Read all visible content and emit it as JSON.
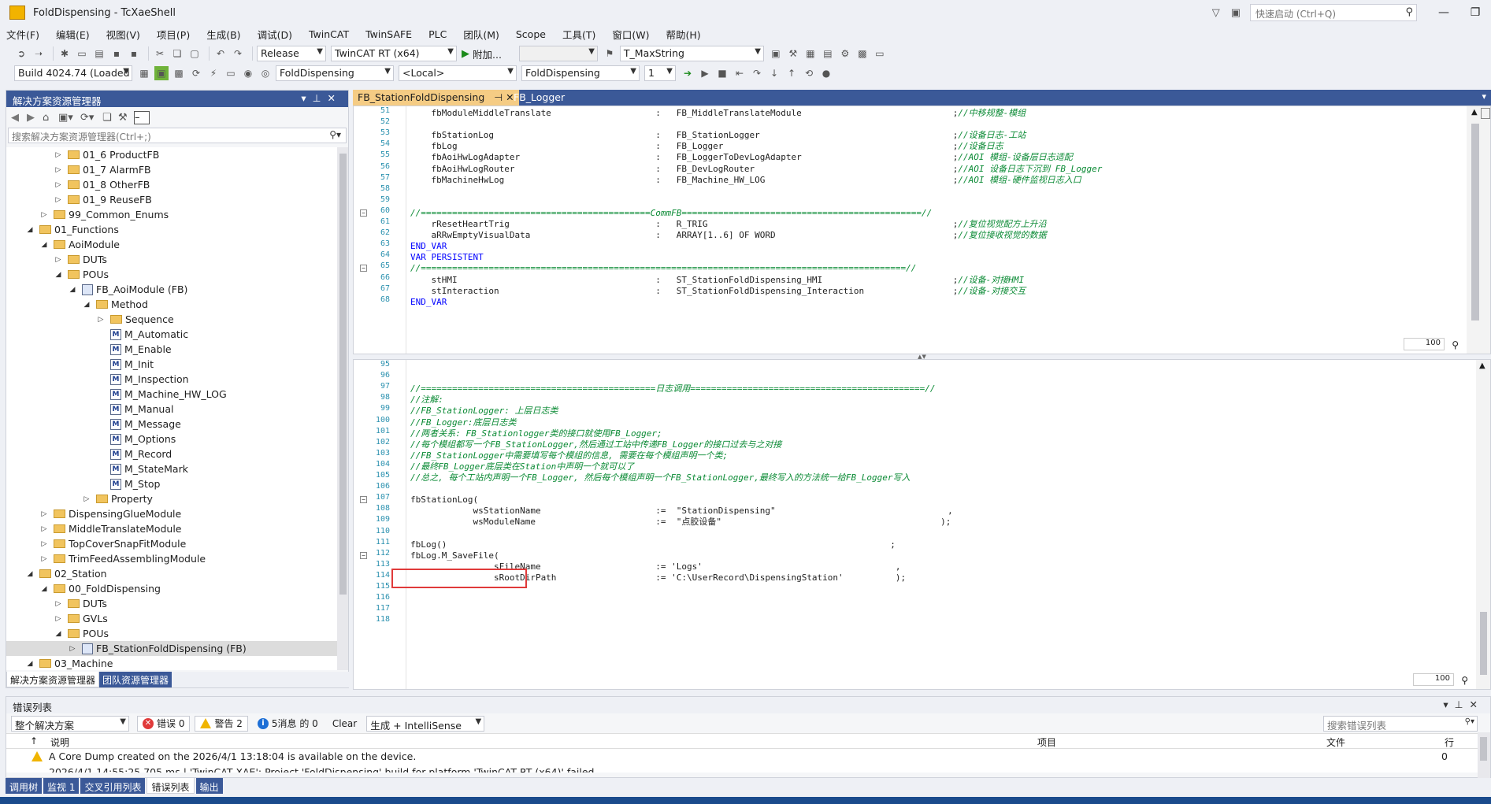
{
  "window": {
    "title": "FoldDispensing - TcXaeShell",
    "quick_launch_placeholder": "快速启动 (Ctrl+Q)"
  },
  "menu": [
    "文件(F)",
    "编辑(E)",
    "视图(V)",
    "项目(P)",
    "生成(B)",
    "调试(D)",
    "TwinCAT",
    "TwinSAFE",
    "PLC",
    "团队(M)",
    "Scope",
    "工具(T)",
    "窗口(W)",
    "帮助(H)"
  ],
  "toolbar1": {
    "config": "Release",
    "platform": "TwinCAT RT (x64)",
    "attach": "附加...",
    "find_combo": "T_MaxString"
  },
  "toolbar2": {
    "build": "Build 4024.74 (Loaded",
    "project": "FoldDispensing",
    "target": "<Local>",
    "plc_project": "FoldDispensing",
    "task": "1"
  },
  "solution_explorer": {
    "title": "解决方案资源管理器",
    "search_placeholder": "搜索解决方案资源管理器(Ctrl+;)",
    "nodes": [
      {
        "label": "01_6 ProductFB"
      },
      {
        "label": "01_7 AlarmFB"
      },
      {
        "label": "01_8 OtherFB"
      },
      {
        "label": "01_9 ReuseFB"
      },
      {
        "label": "99_Common_Enums"
      },
      {
        "label": "01_Functions"
      },
      {
        "label": "AoiModule"
      },
      {
        "label": "DUTs"
      },
      {
        "label": "POUs"
      },
      {
        "label": "FB_AoiModule (FB)"
      },
      {
        "label": "Method"
      },
      {
        "label": "Sequence"
      },
      {
        "label": "M_Automatic"
      },
      {
        "label": "M_Enable"
      },
      {
        "label": "M_Init"
      },
      {
        "label": "M_Inspection"
      },
      {
        "label": "M_Machine_HW_LOG"
      },
      {
        "label": "M_Manual"
      },
      {
        "label": "M_Message"
      },
      {
        "label": "M_Options"
      },
      {
        "label": "M_Record"
      },
      {
        "label": "M_StateMark"
      },
      {
        "label": "M_Stop"
      },
      {
        "label": "Property"
      },
      {
        "label": "DispensingGlueModule"
      },
      {
        "label": "MiddleTranslateModule"
      },
      {
        "label": "TopCoverSnapFitModule"
      },
      {
        "label": "TrimFeedAssemblingModule"
      },
      {
        "label": "02_Station"
      },
      {
        "label": "00_FoldDispensing"
      },
      {
        "label": "DUTs"
      },
      {
        "label": "GVLs"
      },
      {
        "label": "POUs"
      },
      {
        "label": "FB_StationFoldDispensing (FB)"
      },
      {
        "label": "03_Machine"
      }
    ],
    "bottom_tabs": [
      "解决方案资源管理器",
      "团队资源管理器"
    ]
  },
  "doc_tabs": [
    "FB_StationFoldDispensing",
    "FB_Logger"
  ],
  "decl_editor": {
    "zoom": "100",
    "lines": [
      {
        "n": "51",
        "t": "    fbModuleMiddleTranslate                    :   FB_MiddleTranslateModule                             ;",
        "c": "//中移规整-模组"
      },
      {
        "n": "52",
        "t": "",
        "c": ""
      },
      {
        "n": "53",
        "t": "    fbStationLog                               :   FB_StationLogger                                     ;",
        "c": "//设备日志-工站"
      },
      {
        "n": "54",
        "t": "    fbLog                                      :   FB_Logger                                            ;",
        "c": "//设备日志"
      },
      {
        "n": "55",
        "t": "    fbAoiHwLogAdapter                          :   FB_LoggerToDevLogAdapter                             ;",
        "c": "//AOI 模组-设备层日志适配"
      },
      {
        "n": "56",
        "t": "    fbAoiHwLogRouter                           :   FB_DevLogRouter                                      ;",
        "c": "//AOI 设备日志下沉到 FB_Logger"
      },
      {
        "n": "57",
        "t": "    fbMachineHwLog                             :   FB_Machine_HW_LOG                                    ;",
        "c": "//AOI 模组-硬件监视日志入口"
      },
      {
        "n": "58",
        "t": "",
        "c": ""
      },
      {
        "n": "59",
        "t": "",
        "c": ""
      },
      {
        "n": "60",
        "t": "",
        "c": "//============================================CommFB==============================================//"
      },
      {
        "n": "61",
        "t": "    rResetHeartTrig                            :   R_TRIG                                               ;",
        "c": "//复位视觉配方上升沿"
      },
      {
        "n": "62",
        "t": "    aRRwEmptyVisualData                        :   ARRAY[1..6] OF WORD                                  ;",
        "c": "//复位接收视觉的数据"
      },
      {
        "n": "63",
        "t": "END_VAR",
        "c": ""
      },
      {
        "n": "64",
        "t": "VAR PERSISTENT",
        "c": ""
      },
      {
        "n": "65",
        "t": "",
        "c": "//=============================================================================================//"
      },
      {
        "n": "66",
        "t": "    stHMI                                      :   ST_StationFoldDispensing_HMI                         ;",
        "c": "//设备-对接HMI"
      },
      {
        "n": "67",
        "t": "    stInteraction                              :   ST_StationFoldDispensing_Interaction                 ;",
        "c": "//设备-对接交互"
      },
      {
        "n": "68",
        "t": "END_VAR",
        "c": ""
      }
    ]
  },
  "impl_editor": {
    "zoom": "100",
    "lines": [
      {
        "n": "95",
        "t": "",
        "c": ""
      },
      {
        "n": "96",
        "t": "",
        "c": ""
      },
      {
        "n": "97",
        "t": "",
        "c": "//=============================================日志调用=============================================//"
      },
      {
        "n": "98",
        "t": "",
        "c": "//注解:"
      },
      {
        "n": "99",
        "t": "",
        "c": "//FB_StationLogger: 上层日志类"
      },
      {
        "n": "100",
        "t": "",
        "c": "//FB_Logger:底层日志类"
      },
      {
        "n": "101",
        "t": "",
        "c": "//两者关系: FB_Stationlogger类的接口就使用FB_Logger;"
      },
      {
        "n": "102",
        "t": "",
        "c": "//每个模组都写一个FB_StationLogger,然后通过工站中传递FB_Logger的接口过去与之对接"
      },
      {
        "n": "103",
        "t": "",
        "c": "//FB_StationLogger中需要填写每个模组的信息, 需要在每个模组声明一个类;"
      },
      {
        "n": "104",
        "t": "",
        "c": "//最终FB_Logger底层类在Station中声明一个就可以了"
      },
      {
        "n": "105",
        "t": "",
        "c": "//总之, 每个工站内声明一个FB_Logger, 然后每个模组声明一个FB_StationLogger,最终写入的方法统一给FB_Logger写入"
      },
      {
        "n": "106",
        "t": "",
        "c": ""
      },
      {
        "n": "107",
        "t": "fbStationLog(",
        "c": ""
      },
      {
        "n": "108",
        "t": "            wsStationName                      :=  \"StationDispensing\"                                 ,",
        "c": ""
      },
      {
        "n": "109",
        "t": "            wsModuleName                       :=  \"点胶设备\"                                          );",
        "c": ""
      },
      {
        "n": "110",
        "t": "",
        "c": ""
      },
      {
        "n": "111",
        "t": "fbLog()                                                                                     ;",
        "c": ""
      },
      {
        "n": "112",
        "t": "fbLog.M_SaveFile(",
        "c": ""
      },
      {
        "n": "113",
        "t": "                sFileName                      := 'Logs'                                     ,",
        "c": ""
      },
      {
        "n": "114",
        "t": "                sRootDirPath                   := 'C:\\UserRecord\\DispensingStation'          );",
        "c": ""
      },
      {
        "n": "115",
        "t": "",
        "c": ""
      },
      {
        "n": "116",
        "t": "",
        "c": ""
      },
      {
        "n": "117",
        "t": "",
        "c": ""
      },
      {
        "n": "118",
        "t": "",
        "c": ""
      }
    ]
  },
  "error_list": {
    "title": "错误列表",
    "scope": "整个解决方案",
    "errors": "错误 0",
    "warnings": "警告 2",
    "messages": "5消息 的 0",
    "clear": "Clear",
    "source": "生成 + IntelliSense",
    "search_placeholder": "搜索错误列表",
    "columns": [
      "说明",
      "项目",
      "文件",
      "行"
    ],
    "rows": [
      {
        "desc": "A Core Dump created on the 2026/4/1 13:18:04 is available on the device.",
        "line": "0"
      },
      {
        "desc": "2026/4/1 14:55:25 705 ms | 'TwinCAT XAE': Project 'FoldDispensing' build for platform 'TwinCAT RT (x64)' failed",
        "line": ""
      }
    ]
  },
  "bottom_tabs": [
    "调用树",
    "监视 1",
    "交叉引用列表",
    "错误列表",
    "输出"
  ]
}
